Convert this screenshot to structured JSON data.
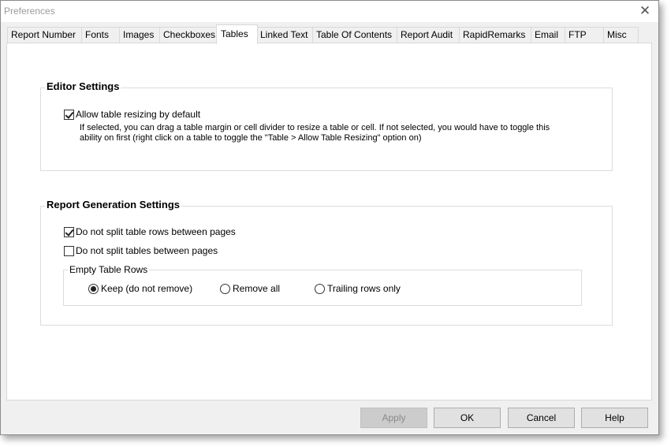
{
  "window": {
    "title": "Preferences"
  },
  "tabs": [
    {
      "label": "Report Number"
    },
    {
      "label": "Fonts"
    },
    {
      "label": "Images"
    },
    {
      "label": "Checkboxes"
    },
    {
      "label": "Tables",
      "active": true
    },
    {
      "label": "Linked Text"
    },
    {
      "label": "Table Of Contents"
    },
    {
      "label": "Report Audit"
    },
    {
      "label": "RapidRemarks"
    },
    {
      "label": "Email"
    },
    {
      "label": "FTP"
    },
    {
      "label": "Misc"
    }
  ],
  "editor_settings": {
    "title": "Editor Settings",
    "allow_resize": {
      "label": "Allow table resizing by default",
      "checked": true,
      "description_line1": "If selected, you can drag a table margin or cell divider to resize a table or cell.  If not selected, you would have to toggle this",
      "description_line2": "ability on first (right click on a table to toggle the \"Table > Allow Table Resizing\" option on)"
    }
  },
  "report_generation": {
    "title": "Report Generation Settings",
    "no_split_rows": {
      "label": "Do not split table rows between pages",
      "checked": true
    },
    "no_split_tables": {
      "label": "Do not split tables between pages",
      "checked": false
    },
    "empty_rows": {
      "title": "Empty Table Rows",
      "options": [
        {
          "label": "Keep (do not remove)",
          "selected": true
        },
        {
          "label": "Remove all",
          "selected": false
        },
        {
          "label": "Trailing rows only",
          "selected": false
        }
      ]
    }
  },
  "buttons": {
    "apply": "Apply",
    "ok": "OK",
    "cancel": "Cancel",
    "help": "Help"
  },
  "icons": {
    "close": "close-icon"
  }
}
